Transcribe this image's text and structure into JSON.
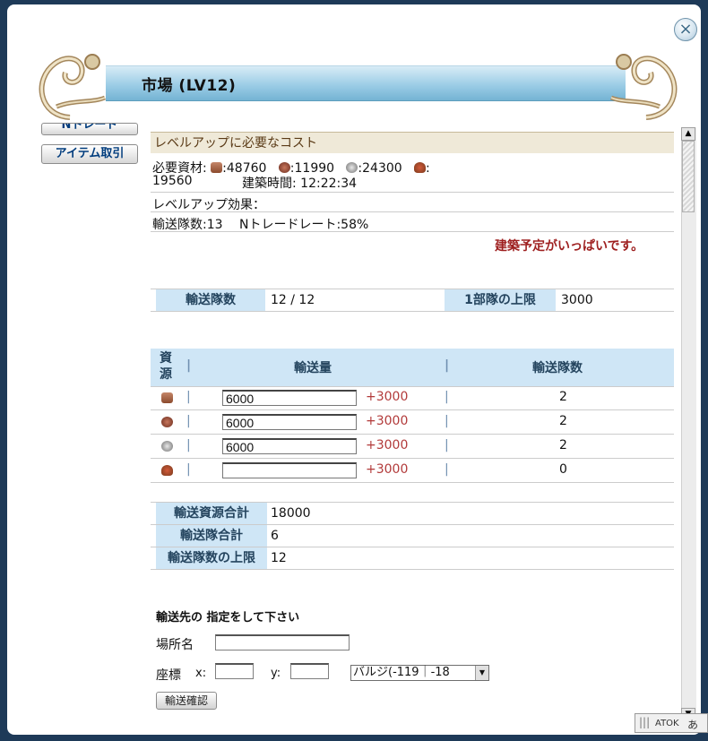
{
  "window": {
    "title": "市場 (LV12)",
    "close_icon": "×"
  },
  "sidebar": {
    "buttons": [
      "Nトレード",
      "アイテム取引"
    ]
  },
  "cost": {
    "heading": "レベルアップに必要なコスト",
    "materials_label": "必要資材:",
    "wood": ":48760",
    "stone": ":11990",
    "iron": ":24300",
    "food_prefix": ":",
    "food_value": "19560",
    "build_time": "建築時間: 12:22:34",
    "effect_label": "レベルアップ効果：",
    "effect_value": "輸送隊数:13　 Nトレードレート:58%",
    "warning": "建築予定がいっぱいです。"
  },
  "squads": {
    "count_label": "輸送隊数",
    "count_value": "12 / 12",
    "limit_label": "1部隊の上限",
    "limit_value": "3000"
  },
  "transport_table": {
    "headers": [
      "資源",
      "輸送量",
      "輸送隊数"
    ],
    "rows": [
      {
        "resource": "wood-icon",
        "amount": "6000",
        "plus": "+3000",
        "squads": "2"
      },
      {
        "resource": "stone-icon",
        "amount": "6000",
        "plus": "+3000",
        "squads": "2"
      },
      {
        "resource": "iron-icon",
        "amount": "6000",
        "plus": "+3000",
        "squads": "2"
      },
      {
        "resource": "food-icon",
        "amount": "",
        "plus": "+3000",
        "squads": "0"
      }
    ]
  },
  "totals": [
    {
      "label": "輸送資源合計",
      "value": "18000"
    },
    {
      "label": "輸送隊合計",
      "value": "6"
    },
    {
      "label": "輸送隊数の上限",
      "value": "12"
    }
  ],
  "destination": {
    "heading": "輸送先の 指定をして下さい",
    "place_label": "場所名",
    "coord_label": "座標",
    "x_label": "x:",
    "y_label": "y:",
    "select_value": "バルジ(-119｜-18",
    "confirm": "輸送確認"
  },
  "ime": {
    "label1": "ATOK",
    "label2": "あ"
  },
  "colors": {
    "header_blue": "#9ccde6",
    "label_blue": "#cfe6f6",
    "warning": "#9e1f1f",
    "plus": "#b23a3a"
  }
}
